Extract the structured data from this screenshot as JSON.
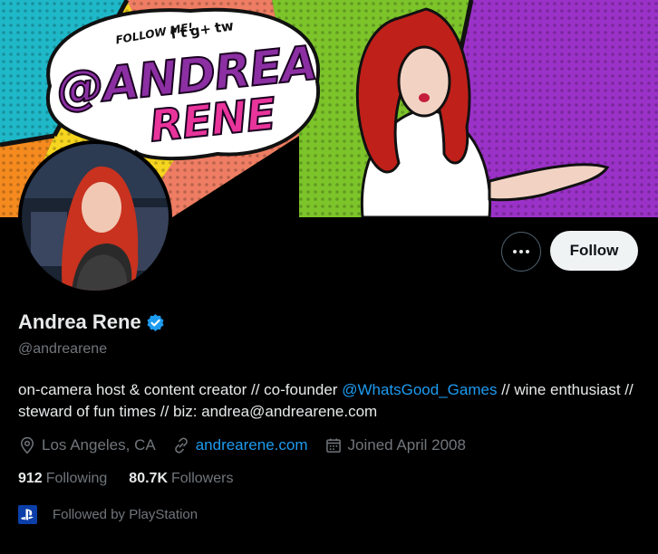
{
  "banner": {
    "follow_text": "FOLLOW ME!",
    "icons": [
      "f",
      "t",
      "g+",
      "tw"
    ],
    "handle_text": "@ANDREA",
    "name_text": "RENE",
    "colors": {
      "purple": "#8b2fa3",
      "pink": "#e8349b",
      "green": "#7cc42a",
      "orange": "#f58a1f",
      "cyan": "#1fb8c8",
      "violet": "#9b32c8"
    }
  },
  "profile": {
    "display_name": "Andrea Rene",
    "handle": "@andrearene",
    "bio_pre": "on-camera host & content creator // co-founder ",
    "bio_mention": "@WhatsGood_Games",
    "bio_post": " // wine enthusiast // steward of fun times // biz: andrea@andrearene.com",
    "location": "Los Angeles, CA",
    "website": "andrearene.com",
    "joined": "Joined April 2008",
    "following_count": "912",
    "following_label": "Following",
    "followers_count": "80.7K",
    "followers_label": "Followers",
    "followed_by": "Followed by PlayStation"
  },
  "actions": {
    "follow_label": "Follow"
  },
  "colors": {
    "accent": "#1d9bf0",
    "muted": "#71767b",
    "text": "#e7e9ea",
    "background": "#000000"
  }
}
